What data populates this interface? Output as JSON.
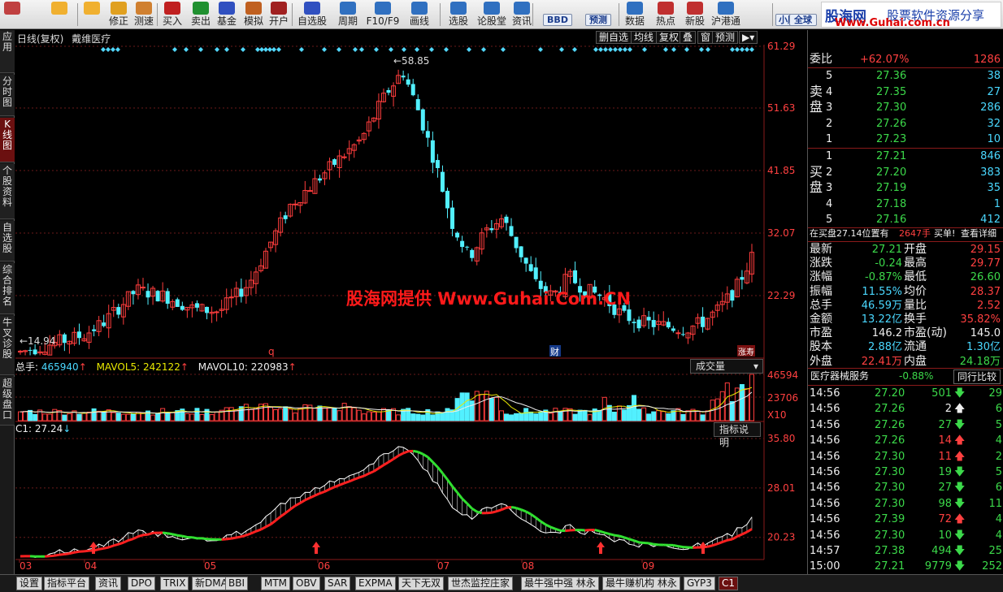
{
  "toolbar": {
    "items": [
      {
        "label": "",
        "icon": "grid-icon"
      },
      {
        "label": "",
        "icon": "back-arrow-icon"
      },
      {
        "label": "",
        "icon": "down-arrow-icon"
      },
      {
        "label": "修正",
        "icon": "edit-icon"
      },
      {
        "label": "测速",
        "icon": "clock-icon"
      },
      {
        "label": "买入",
        "icon": "buy-icon"
      },
      {
        "label": "卖出",
        "icon": "sell-icon"
      },
      {
        "label": "基金",
        "icon": "fund-icon"
      },
      {
        "label": "模拟",
        "icon": "hammer-icon"
      },
      {
        "label": "开户",
        "icon": "account-icon"
      },
      {
        "label": "自选股",
        "icon": "star-icon"
      },
      {
        "label": "周期",
        "icon": "cycle-icon"
      },
      {
        "label": "F10/F9",
        "icon": "f10-icon"
      },
      {
        "label": "画线",
        "icon": "draw-icon"
      },
      {
        "label": "选股",
        "icon": "select-icon"
      },
      {
        "label": "论股堂",
        "icon": "forum-icon"
      },
      {
        "label": "资讯",
        "icon": "news-icon"
      },
      {
        "label": "数据",
        "icon": "data-icon"
      },
      {
        "label": "热点",
        "icon": "hot-icon"
      },
      {
        "label": "新股",
        "icon": "ipo-icon"
      },
      {
        "label": "沪港通",
        "icon": "hk-icon"
      }
    ],
    "pills": [
      "BBD",
      "预测",
      "小股",
      "全球"
    ]
  },
  "banner": {
    "name": "股海网",
    "slogan": "股票软件资源分享",
    "url": "Www.Guhai.com.cn"
  },
  "sidebar": {
    "items": [
      "应用",
      "分时图",
      "K线图",
      "个股资料",
      "自选股",
      "综合排名",
      "牛叉诊股",
      "超级盘口"
    ],
    "active_index": 2
  },
  "chart": {
    "period": "日线(复权)",
    "name": "戴维医疗",
    "buttons": [
      "删自选",
      "均线",
      "复权",
      "叠",
      "窗",
      "预测"
    ],
    "y_labels": [
      "61.29",
      "51.63",
      "41.85",
      "32.07",
      "22.29"
    ],
    "high_label": "58.85",
    "low_label": "14.94",
    "markers": [
      "q",
      "财",
      "涨寿"
    ],
    "dates": [
      "03",
      "04",
      "05",
      "06",
      "07",
      "08",
      "09"
    ]
  },
  "volume": {
    "label_zs": "总手:",
    "zs": "465940",
    "label_m5": "MAVOL5:",
    "m5": "242122",
    "label_m10": "MAVOL10:",
    "m10": "220983",
    "y_labels": [
      "46594",
      "23706"
    ],
    "unit": "X10",
    "button": "成交量"
  },
  "indicator": {
    "name": "C1:",
    "value": "27.24",
    "y_labels": [
      "35.80",
      "28.01",
      "20.23"
    ],
    "button": "指标说明"
  },
  "watermark": "股海网提供 Www.Guhai.Com.CN",
  "right_panel": {
    "wb": {
      "label": "委比",
      "pct": "+62.07%",
      "diff": "1286"
    },
    "sell": [
      {
        "n": "5",
        "p": "27.36",
        "v": "38"
      },
      {
        "n": "4",
        "p": "27.35",
        "v": "27"
      },
      {
        "n": "3",
        "p": "27.30",
        "v": "286"
      },
      {
        "n": "2",
        "p": "27.26",
        "v": "32"
      },
      {
        "n": "1",
        "p": "27.23",
        "v": "10"
      }
    ],
    "buy": [
      {
        "n": "1",
        "p": "27.21",
        "v": "846"
      },
      {
        "n": "2",
        "p": "27.20",
        "v": "383"
      },
      {
        "n": "3",
        "p": "27.19",
        "v": "35"
      },
      {
        "n": "4",
        "p": "27.18",
        "v": "1"
      },
      {
        "n": "5",
        "p": "27.16",
        "v": "412"
      }
    ],
    "sell_label": "卖盘",
    "buy_label": "买盘",
    "notice": {
      "a": "在买盘27.14位置有",
      "b": "2647手",
      "c": "买单!",
      "d": "查看详细"
    },
    "quote": [
      {
        "k1": "最新",
        "v1": "27.21",
        "k2": "开盘",
        "v2": "29.15"
      },
      {
        "k1": "涨跌",
        "v1": "-0.24",
        "k2": "最高",
        "v2": "29.77"
      },
      {
        "k1": "涨幅",
        "v1": "-0.87%",
        "k2": "最低",
        "v2": "26.60"
      },
      {
        "k1": "振幅",
        "v1": "11.55%",
        "k2": "均价",
        "v2": "28.37"
      },
      {
        "k1": "总手",
        "v1": "46.59万",
        "k2": "量比",
        "v2": "2.52"
      },
      {
        "k1": "金额",
        "v1": "13.22亿",
        "k2": "换手",
        "v2": "35.82%"
      },
      {
        "k1": "市盈",
        "v1": "146.2",
        "k2": "市盈(动)",
        "v2": "145.0"
      },
      {
        "k1": "股本",
        "v1": "2.88亿",
        "k2": "流通",
        "v2": "1.30亿"
      },
      {
        "k1": "外盘",
        "v1": "22.41万",
        "k2": "内盘",
        "v2": "24.18万"
      }
    ],
    "sector": {
      "name": "医疗器械服务",
      "pct": "-0.88%",
      "button": "同行比较"
    },
    "ticks": [
      {
        "t": "14:56",
        "p": "27.20",
        "v": "501",
        "d": "down",
        "x": "29"
      },
      {
        "t": "14:56",
        "p": "27.26",
        "v": "2",
        "d": "up-white",
        "x": "6"
      },
      {
        "t": "14:56",
        "p": "27.26",
        "v": "27",
        "d": "down",
        "x": "5"
      },
      {
        "t": "14:56",
        "p": "27.26",
        "v": "14",
        "d": "up",
        "x": "4"
      },
      {
        "t": "14:56",
        "p": "27.30",
        "v": "11",
        "d": "up",
        "x": "2"
      },
      {
        "t": "14:56",
        "p": "27.30",
        "v": "19",
        "d": "down",
        "x": "5"
      },
      {
        "t": "14:56",
        "p": "27.30",
        "v": "27",
        "d": "down",
        "x": "6"
      },
      {
        "t": "14:56",
        "p": "27.30",
        "v": "98",
        "d": "down",
        "x": "11"
      },
      {
        "t": "14:56",
        "p": "27.39",
        "v": "72",
        "d": "up",
        "x": "4"
      },
      {
        "t": "14:56",
        "p": "27.30",
        "v": "10",
        "d": "down",
        "x": "4"
      },
      {
        "t": "14:57",
        "p": "27.38",
        "v": "494",
        "d": "down",
        "x": "25"
      },
      {
        "t": "15:00",
        "p": "27.21",
        "v": "9779",
        "d": "down",
        "x": "252"
      }
    ]
  },
  "bottom_tabs": [
    "设置",
    "指标平台",
    "资讯",
    "DPO",
    "TRIX",
    "新DMA",
    "BBI",
    "MTM",
    "OBV",
    "SAR",
    "EXPMA",
    "天下无双",
    "世杰监控庄家",
    "最牛强中强 林永",
    "最牛赚机构 林永",
    "GYP3",
    "C1"
  ],
  "bottom_active": 16,
  "colors": {
    "up": "#ff3d3d",
    "down": "#52f0ff",
    "grid": "#6a1a1a",
    "ma_red": "#ff2020",
    "ma_green": "#30e030",
    "signal": "#ff3030"
  }
}
